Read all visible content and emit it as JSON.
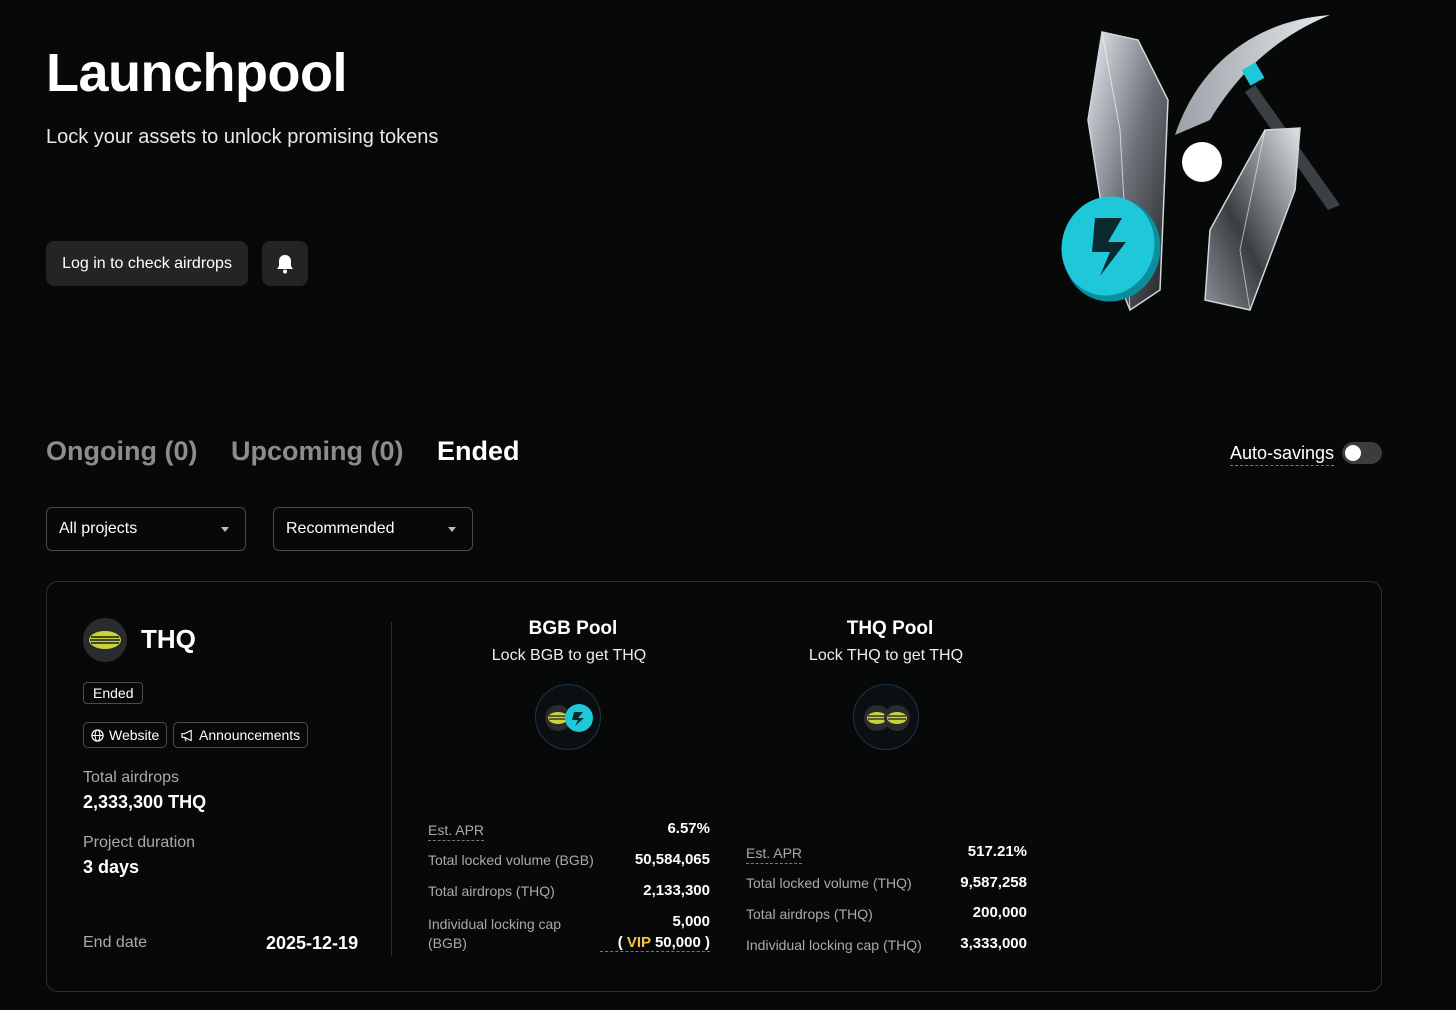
{
  "hero": {
    "title": "Launchpool",
    "subtitle": "Lock your assets to unlock promising tokens",
    "login_label": "Log in to check airdrops"
  },
  "tabs": [
    {
      "label": "Ongoing (0)",
      "active": false
    },
    {
      "label": "Upcoming (0)",
      "active": false
    },
    {
      "label": "Ended",
      "active": true
    }
  ],
  "auto_savings": {
    "label": "Auto-savings",
    "enabled": false
  },
  "filters": {
    "project_filter": "All projects",
    "sort": "Recommended"
  },
  "project": {
    "name": "THQ",
    "status": "Ended",
    "links": {
      "website": "Website",
      "announcements": "Announcements"
    },
    "total_airdrops_label": "Total airdrops",
    "total_airdrops_value": "2,333,300 THQ",
    "duration_label": "Project duration",
    "duration_value": "3 days",
    "end_date_label": "End date",
    "end_date_value": "2025-12-19"
  },
  "pools": [
    {
      "title": "BGB Pool",
      "subtitle": "Lock BGB to get THQ",
      "apr_label": "Est. APR",
      "apr_value": "6.57%",
      "locked_label": "Total locked volume (BGB)",
      "locked_value": "50,584,065",
      "airdrops_label": "Total airdrops (THQ)",
      "airdrops_value": "2,133,300",
      "cap_label_line1": "Individual locking cap",
      "cap_label_line2": "(BGB)",
      "cap_value": "5,000",
      "vip_prefix": "( ",
      "vip_label": "VIP",
      "vip_value": " 50,000 )"
    },
    {
      "title": "THQ Pool",
      "subtitle": "Lock THQ to get THQ",
      "apr_label": "Est. APR",
      "apr_value": "517.21%",
      "locked_label": "Total locked volume (THQ)",
      "locked_value": "9,587,258",
      "airdrops_label": "Total airdrops (THQ)",
      "airdrops_value": "200,000",
      "cap_label": "Individual locking cap (THQ)",
      "cap_value": "3,333,000"
    }
  ],
  "colors": {
    "background": "#070808",
    "accent_cyan": "#1ec8d8",
    "vip_gold": "#f5c542",
    "token_green": "#c8d23a"
  },
  "icons": {
    "notify": "bell-icon",
    "website": "globe-icon",
    "announcements": "megaphone-icon",
    "filter_caret": "caret-down-icon"
  }
}
